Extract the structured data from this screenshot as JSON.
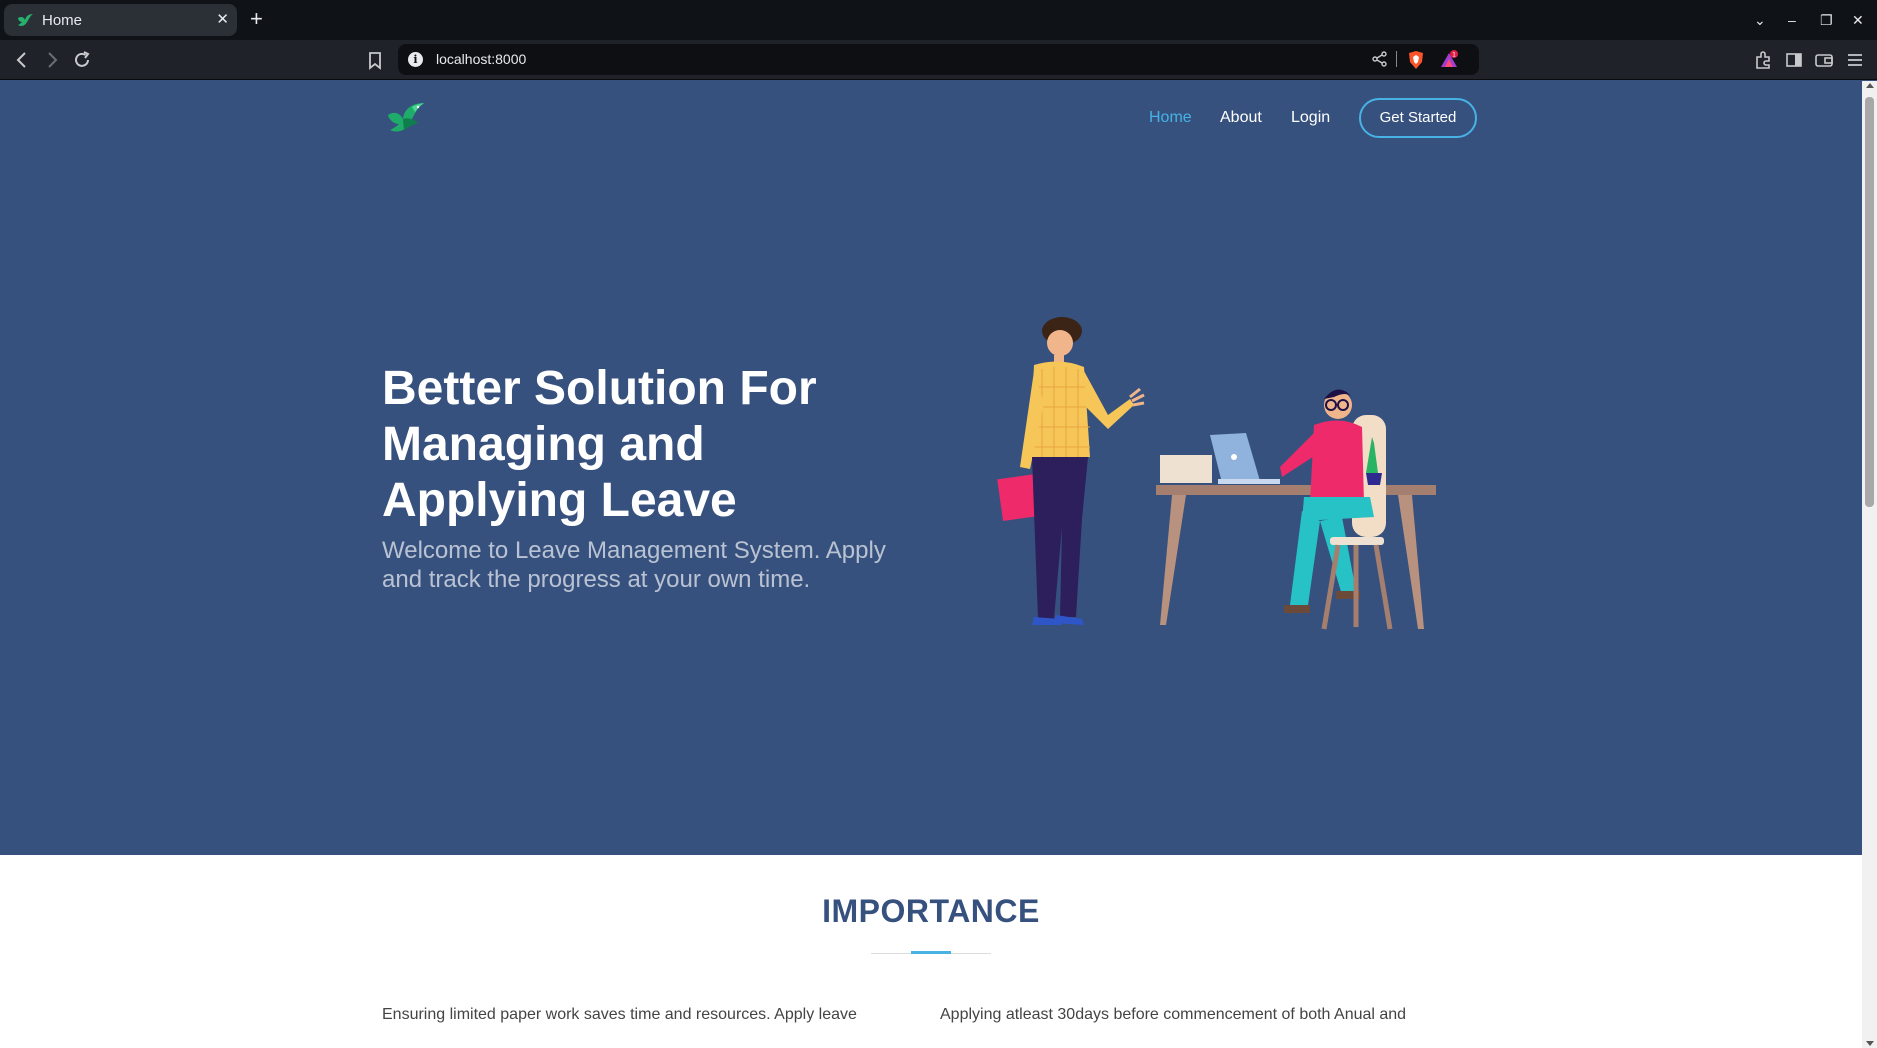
{
  "browser": {
    "tab_title": "Home",
    "tab_close": "✕",
    "new_tab": "+",
    "url": "localhost:8000",
    "rewards_count": "1",
    "icons": [
      "back-icon",
      "forward-icon",
      "reload-icon",
      "bookmark-icon",
      "site-info-icon",
      "share-icon",
      "brave-shields-icon",
      "brave-rewards-icon",
      "extensions-icon",
      "sidebar-icon",
      "wallet-icon",
      "menu-icon",
      "tab-search-icon",
      "minimize-icon",
      "restore-icon",
      "close-window-icon"
    ],
    "window": {
      "dropdown": "⌄",
      "minimize": "–",
      "restore": "❐",
      "close": "✕"
    }
  },
  "nav": {
    "home": "Home",
    "about": "About",
    "login": "Login",
    "get_started": "Get Started"
  },
  "hero": {
    "title": "Better Solution For Managing and Applying Leave",
    "subtitle": "Welcome to Leave Management System. Apply and track the progress at your own time."
  },
  "section": {
    "heading": "IMPORTANCE",
    "col1": "Ensuring limited paper work saves time and resources. Apply leave",
    "col2": "Applying atleast 30days before commencement of both Anual and"
  },
  "colors": {
    "primary": "#37517e",
    "accent": "#47b2e4",
    "chrome_dark": "#0f1216",
    "white": "#ffffff"
  }
}
